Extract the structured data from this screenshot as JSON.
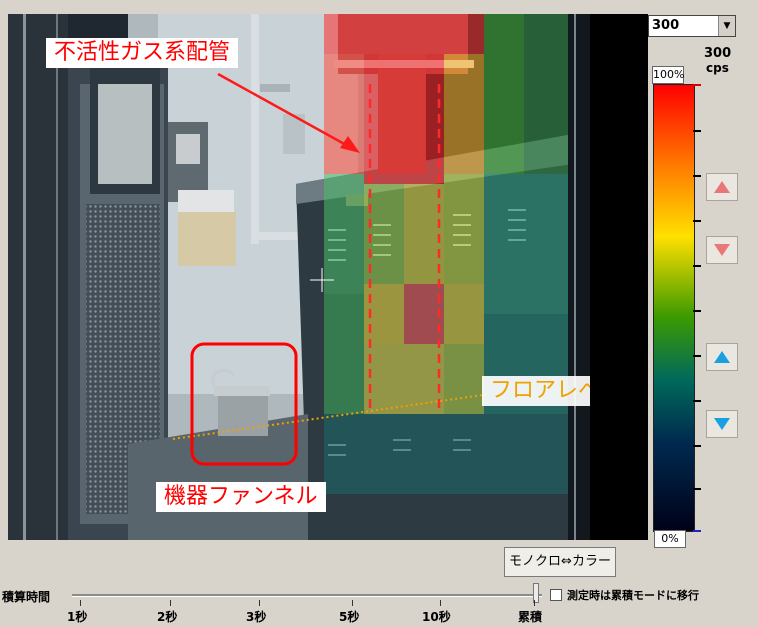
{
  "annotations": {
    "pipe_label": "不活性ガス系配管",
    "floor_label": "フロアレベル",
    "funnel_label": "機器ファンネル",
    "annotation_color": "#ff0000",
    "floor_line_color": "#f0a000"
  },
  "controls": {
    "range_value": "300",
    "scale_max": "300",
    "scale_unit": "cps",
    "pct_top": "100%",
    "pct_bottom": "0%",
    "mode_button": "モノクロ⇔カラー",
    "accum_label": "積算時間",
    "checkbox_label": "測定時は累積モードに移行",
    "checkbox_checked": false
  },
  "time_ticks": [
    "1秒",
    "2秒",
    "3秒",
    "5秒",
    "10秒",
    "累積"
  ],
  "arrow_buttons": [
    {
      "name": "scale-up-red-icon",
      "color": "#e87878"
    },
    {
      "name": "scale-down-red-icon",
      "color": "#e87878"
    },
    {
      "name": "scale-up-blue-icon",
      "color": "#1aa0e0"
    },
    {
      "name": "scale-down-blue-icon",
      "color": "#1aa0e0"
    }
  ]
}
